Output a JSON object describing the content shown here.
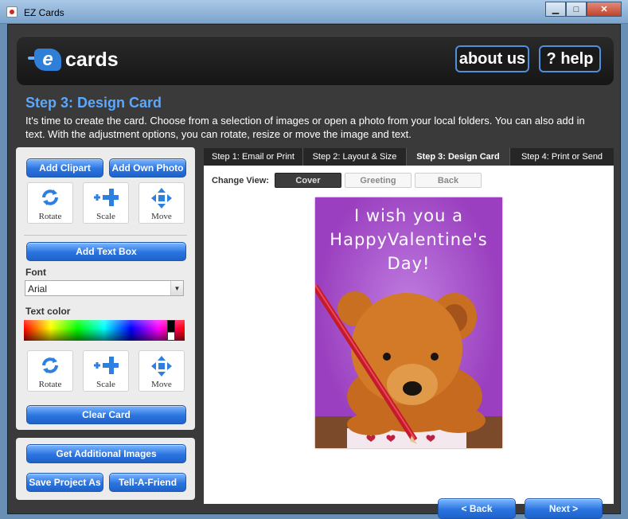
{
  "window": {
    "title": "EZ Cards"
  },
  "header": {
    "logo_text": "cards",
    "about_label": "about us",
    "help_label": "? help"
  },
  "intro": {
    "step_title": "Step 3: Design Card",
    "description": "It's time to create the card. Choose from a selection of images or open a photo from your local folders. You can also add in text. With the adjustment options, you can rotate, resize or move the image and text."
  },
  "tools": {
    "add_clipart": "Add Clipart",
    "add_photo": "Add Own Photo",
    "image_tools": [
      "Rotate",
      "Scale",
      "Move"
    ],
    "add_textbox": "Add Text Box",
    "font_label": "Font",
    "font_value": "Arial",
    "text_color_label": "Text color",
    "text_tools": [
      "Rotate",
      "Scale",
      "Move"
    ],
    "clear_card": "Clear Card"
  },
  "extra": {
    "get_images": "Get Additional Images",
    "save_project": "Save Project As",
    "tell_friend": "Tell-A-Friend"
  },
  "steps": [
    "Step 1: Email or Print",
    "Step 2: Layout & Size",
    "Step 3: Design Card",
    "Step 4: Print or Send"
  ],
  "active_step": 2,
  "view": {
    "label": "Change View:",
    "tabs": [
      "Cover",
      "Greeting",
      "Back"
    ],
    "active": 0
  },
  "card": {
    "lines": [
      "I wish you a",
      "HappyValentine's",
      "Day!"
    ]
  },
  "nav": {
    "back": "< Back",
    "next": "Next >"
  },
  "colors": {
    "accent": "#2a74e0",
    "title_blue": "#5aa8ff",
    "card_purple": "#a44fc6"
  }
}
